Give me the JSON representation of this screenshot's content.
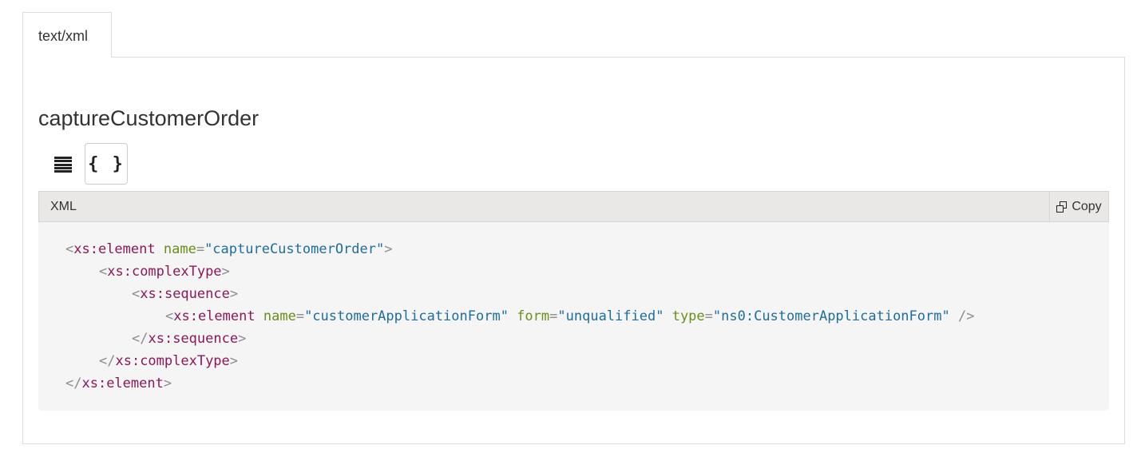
{
  "tab": {
    "label": "text/xml"
  },
  "title": "captureCustomerOrder",
  "view_toggle": {
    "list_icon": "list-icon",
    "code_icon": "braces-icon",
    "code_label": "{ }"
  },
  "code_block": {
    "language_label": "XML",
    "copy_label": "Copy",
    "copy_icon": "copy-icon",
    "lines": {
      "l1": {
        "open": "<",
        "tag": "xs:element",
        "a1": "name",
        "eq1": "=",
        "v1": "\"captureCustomerOrder\"",
        "close": ">"
      },
      "l2": {
        "open": "<",
        "tag": "xs:complexType",
        "close": ">"
      },
      "l3": {
        "open": "<",
        "tag": "xs:sequence",
        "close": ">"
      },
      "l4": {
        "open": "<",
        "tag": "xs:element",
        "a1": "name",
        "eq1": "=",
        "v1": "\"customerApplicationForm\"",
        "a2": "form",
        "eq2": "=",
        "v2": "\"unqualified\"",
        "a3": "type",
        "eq3": "=",
        "v3": "\"ns0:CustomerApplicationForm\"",
        "close": "/>"
      },
      "l5": {
        "open": "</",
        "tag": "xs:sequence",
        "close": ">"
      },
      "l6": {
        "open": "</",
        "tag": "xs:complexType",
        "close": ">"
      },
      "l7": {
        "open": "</",
        "tag": "xs:element",
        "close": ">"
      }
    }
  },
  "colors": {
    "tag": "#8c1858",
    "attribute": "#6a8e1c",
    "value": "#1f6d9c",
    "punctuation": "#8c8c8c",
    "code_background": "#f5f5f5",
    "header_background": "#eae8e6"
  }
}
